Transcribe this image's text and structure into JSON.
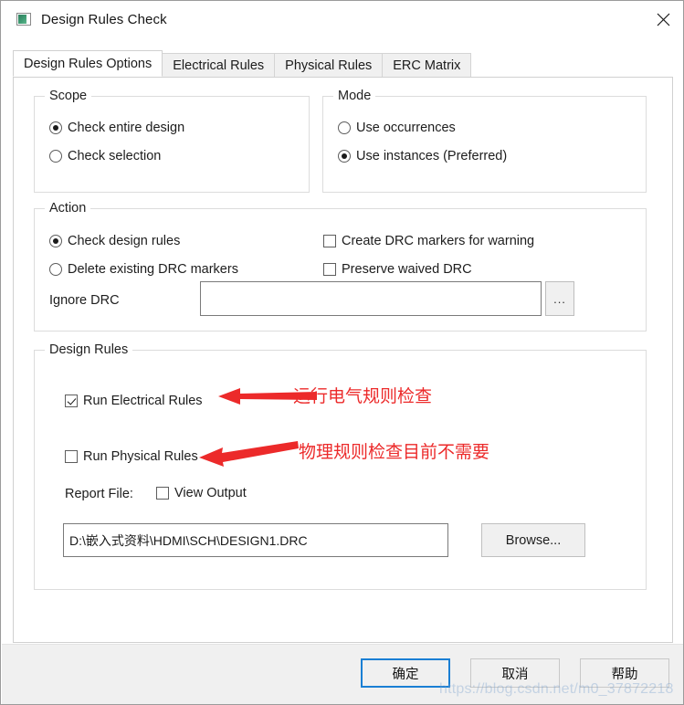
{
  "window": {
    "title": "Design Rules Check",
    "icon": "app-icon",
    "close_label": "✕"
  },
  "tabs": [
    {
      "label": "Design Rules Options",
      "active": true
    },
    {
      "label": "Electrical Rules",
      "active": false
    },
    {
      "label": "Physical Rules",
      "active": false
    },
    {
      "label": "ERC Matrix",
      "active": false
    }
  ],
  "scope": {
    "legend": "Scope",
    "options": [
      {
        "label": "Check entire design",
        "selected": true
      },
      {
        "label": "Check selection",
        "selected": false
      }
    ]
  },
  "mode": {
    "legend": "Mode",
    "options": [
      {
        "label": "Use occurrences",
        "selected": false
      },
      {
        "label": "Use instances (Preferred)",
        "selected": true
      }
    ]
  },
  "action": {
    "legend": "Action",
    "radios": [
      {
        "label": "Check design rules",
        "selected": true
      },
      {
        "label": "Delete existing DRC markers",
        "selected": false
      }
    ],
    "checkboxes": [
      {
        "label": "Create DRC markers for warning",
        "checked": false
      },
      {
        "label": "Preserve waived DRC",
        "checked": false
      }
    ],
    "ignore_drc_label": "Ignore DRC",
    "ignore_drc_value": "",
    "ignore_drc_browse_label": "..."
  },
  "design_rules": {
    "legend": "Design Rules",
    "checkboxes": [
      {
        "label": "Run Electrical Rules",
        "checked": true
      },
      {
        "label": "Run Physical Rules",
        "checked": false
      }
    ],
    "report_file_label": "Report File:",
    "view_output_label": "View Output",
    "view_output_checked": false,
    "report_path": "D:\\嵌入式资料\\HDMI\\SCH\\DESIGN1.DRC",
    "browse_label": "Browse..."
  },
  "annotations": {
    "color": "#ec2a2a",
    "items": [
      {
        "text": "运行电气规则检查"
      },
      {
        "text": "物理规则检查目前不需要"
      }
    ]
  },
  "footer": {
    "ok_label": "确定",
    "cancel_label": "取消",
    "help_label": "帮助"
  },
  "watermark": {
    "text": "https://blog.csdn.net/m0_37872218"
  }
}
